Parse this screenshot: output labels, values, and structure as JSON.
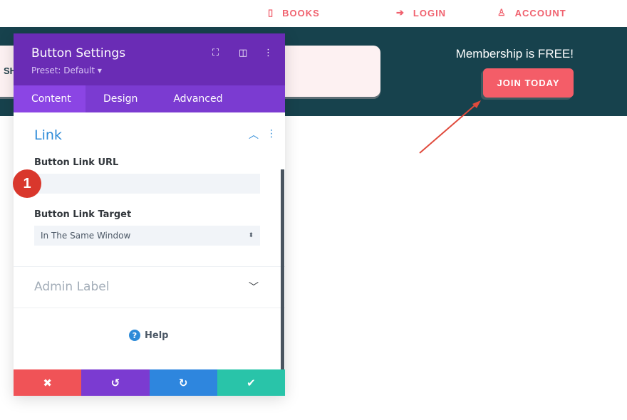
{
  "topnav": {
    "items": [
      {
        "label": "BOOKS",
        "icon": "book-icon"
      },
      {
        "label": "LOGIN",
        "icon": "login-icon"
      },
      {
        "label": "ACCOUNT",
        "icon": "user-icon"
      }
    ]
  },
  "hero": {
    "partial_text": "SH",
    "membership": "Membership is FREE!",
    "join_label": "JOIN TODAY"
  },
  "panel": {
    "title": "Button Settings",
    "preset": "Preset: Default ▾",
    "tabs": [
      "Content",
      "Design",
      "Advanced"
    ],
    "link_section": {
      "title": "Link",
      "url_label": "Button Link URL",
      "url_value": "",
      "target_label": "Button Link Target",
      "target_value": "In The Same Window"
    },
    "admin_label": "Admin Label",
    "help": "Help",
    "badge": "1"
  },
  "colors": {
    "header": "#6a2cb5",
    "accent": "#2e8bd8",
    "cancel": "#f05357",
    "undo": "#7b3bd1",
    "redo": "#2e86de",
    "save": "#29c4a9",
    "band": "#17424d"
  }
}
